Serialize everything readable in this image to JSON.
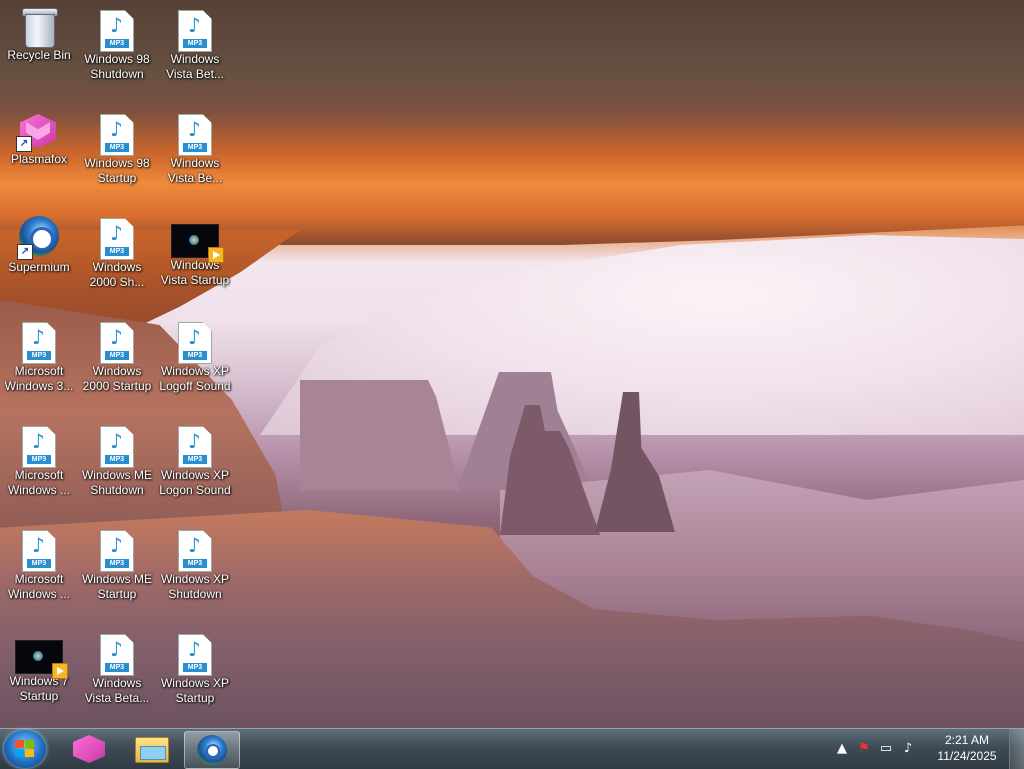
{
  "desktop": {
    "icons": [
      {
        "label": "Recycle Bin",
        "icon": "recycle-bin-icon"
      },
      {
        "label": "Plasmafox",
        "icon": "plasmafox-icon"
      },
      {
        "label": "Supermium",
        "icon": "supermium-icon"
      },
      {
        "label": "Microsoft Windows 3...",
        "icon": "mp3-file-icon"
      },
      {
        "label": "Microsoft Windows ...",
        "icon": "mp3-file-icon"
      },
      {
        "label": "Microsoft Windows ...",
        "icon": "mp3-file-icon"
      },
      {
        "label": "Windows 7 Startup",
        "icon": "video-file-icon"
      },
      {
        "label": "Windows 98 Shutdown",
        "icon": "mp3-file-icon"
      },
      {
        "label": "Windows 98 Startup",
        "icon": "mp3-file-icon"
      },
      {
        "label": "Windows 2000 Sh...",
        "icon": "mp3-file-icon"
      },
      {
        "label": "Windows 2000 Startup",
        "icon": "mp3-file-icon"
      },
      {
        "label": "Windows ME Shutdown",
        "icon": "mp3-file-icon"
      },
      {
        "label": "Windows ME Startup",
        "icon": "mp3-file-icon"
      },
      {
        "label": "Windows Vista Beta...",
        "icon": "mp3-file-icon"
      },
      {
        "label": "Windows Vista Bet...",
        "icon": "mp3-file-icon"
      },
      {
        "label": "Windows Vista Be...",
        "icon": "mp3-file-icon"
      },
      {
        "label": "Windows Vista Startup",
        "icon": "video-file-icon"
      },
      {
        "label": "Windows XP Logoff Sound",
        "icon": "mp3-file-icon"
      },
      {
        "label": "Windows XP Logon Sound",
        "icon": "mp3-file-icon"
      },
      {
        "label": "Windows XP Shutdown",
        "icon": "mp3-file-icon"
      },
      {
        "label": "Windows XP Startup",
        "icon": "mp3-file-icon"
      }
    ],
    "mp3_tag": "MP3"
  },
  "taskbar": {
    "pinned": [
      {
        "name": "Plasmafox",
        "icon": "plasmafox-icon",
        "active": false
      },
      {
        "name": "Windows Explorer",
        "icon": "folder-icon",
        "active": false
      },
      {
        "name": "Supermium",
        "icon": "supermium-icon",
        "active": true
      }
    ],
    "tray": {
      "time": "2:21 AM",
      "date": "11/24/2025"
    }
  }
}
